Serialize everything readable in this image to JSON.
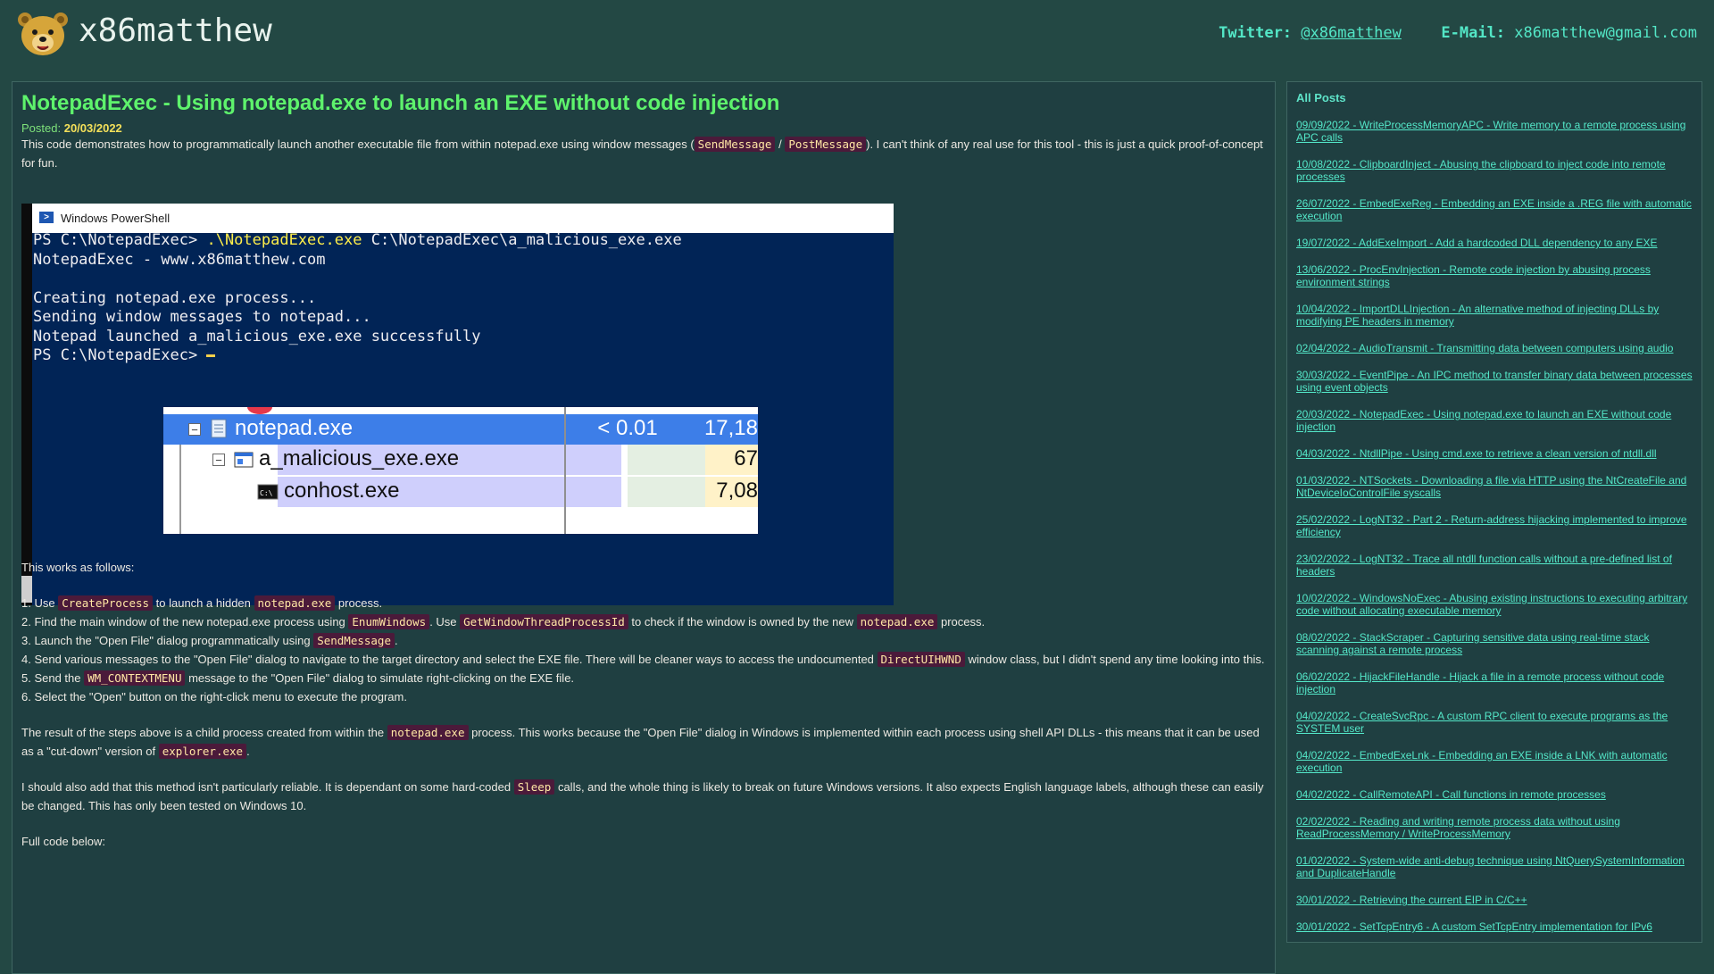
{
  "header": {
    "site_name": "x86matthew",
    "twitter_label": "Twitter:",
    "twitter_handle": "@x86matthew",
    "email_label": "E-Mail:",
    "email": "x86matthew@gmail.com"
  },
  "post": {
    "title": "NotepadExec - Using notepad.exe to launch an EXE without code injection",
    "posted_label": "Posted:",
    "posted_date": "20/03/2022",
    "intro_a": "This code demonstrates how to programmatically launch another executable file from within notepad.exe using window messages (",
    "intro_code1": "SendMessage",
    "intro_sep": " / ",
    "intro_code2": "PostMessage",
    "intro_b": "). I can't think of any real use for this tool - this is just a quick proof-of-concept for fun.",
    "works_as_follows": "This works as follows:",
    "step1": {
      "a": "1. Use ",
      "c1": "CreateProcess",
      "b": " to launch a hidden ",
      "c2": "notepad.exe",
      "d": " process."
    },
    "step2": {
      "a": "2. Find the main window of the new notepad.exe process using ",
      "c1": "EnumWindows",
      "b": ". Use ",
      "c2": "GetWindowThreadProcessId",
      "d": " to check if the window is owned by the new ",
      "c3": "notepad.exe",
      "e": " process."
    },
    "step3": {
      "a": "3. Launch the \"Open File\" dialog programmatically using ",
      "c1": "SendMessage",
      "b": "."
    },
    "step4": {
      "a": "4. Send various messages to the \"Open File\" dialog to navigate to the target directory and select the EXE file. There will be cleaner ways to access the undocumented ",
      "c1": "DirectUIHWND",
      "b": " window class, but I didn't spend any time looking into this."
    },
    "step5": {
      "a": "5. Send the ",
      "c1": "WM_CONTEXTMENU",
      "b": " message to the \"Open File\" dialog to simulate right-clicking on the EXE file."
    },
    "step6": {
      "a": "6. Select the \"Open\" button on the right-click menu to execute the program."
    },
    "result": {
      "a": "The result of the steps above is a child process created from within the ",
      "c1": "notepad.exe",
      "b": " process. This works because the \"Open File\" dialog in Windows is implemented within each process using shell API DLLs - this means that it can be used as a \"cut-down\" version of ",
      "c2": "explorer.exe",
      "d": "."
    },
    "reliability": {
      "a": "I should also add that this method isn't particularly reliable. It is dependant on some hard-coded ",
      "c1": "Sleep",
      "b": " calls, and the whole thing is likely to break on future Windows versions. It also expects English language labels, although these can easily be changed. This has only been tested on Windows 10."
    },
    "full_code": "Full code below:"
  },
  "screenshot": {
    "window_title": "Windows PowerShell",
    "prompt1": "PS C:\\NotepadExec> ",
    "command": ".\\NotepadExec.exe",
    "command_arg": " C:\\NotepadExec\\a_malicious_exe.exe",
    "line2": "NotepadExec - www.x86matthew.com",
    "line3": "Creating notepad.exe process...",
    "line4": "Sending window messages to notepad...",
    "line5": "Notepad launched a_malicious_exe.exe successfully",
    "prompt2": "PS C:\\NotepadExec> ",
    "process_tree": {
      "row1_name": "notepad.exe",
      "row1_cpu": "< 0.01",
      "row1_mem": "17,18",
      "row2_name": "a_malicious_exe.exe",
      "row2_mem": "67",
      "row3_name": "conhost.exe",
      "row3_mem": "7,08"
    }
  },
  "sidebar": {
    "title": "All Posts",
    "posts": [
      "09/09/2022 - WriteProcessMemoryAPC - Write memory to a remote process using APC calls",
      "10/08/2022 - ClipboardInject - Abusing the clipboard to inject code into remote processes",
      "26/07/2022 - EmbedExeReg - Embedding an EXE inside a .REG file with automatic execution",
      "19/07/2022 - AddExeImport - Add a hardcoded DLL dependency to any EXE",
      "13/06/2022 - ProcEnvInjection - Remote code injection by abusing process environment strings",
      "10/04/2022 - ImportDLLInjection - An alternative method of injecting DLLs by modifying PE headers in memory",
      "02/04/2022 - AudioTransmit - Transmitting data between computers using audio",
      "30/03/2022 - EventPipe - An IPC method to transfer binary data between processes using event objects",
      "20/03/2022 - NotepadExec - Using notepad.exe to launch an EXE without code injection",
      "04/03/2022 - NtdllPipe - Using cmd.exe to retrieve a clean version of ntdll.dll",
      "01/03/2022 - NTSockets - Downloading a file via HTTP using the NtCreateFile and NtDeviceIoControlFile syscalls",
      "25/02/2022 - LogNT32 - Part 2 - Return-address hijacking implemented to improve efficiency",
      "23/02/2022 - LogNT32 - Trace all ntdll function calls without a pre-defined list of headers",
      "10/02/2022 - WindowsNoExec - Abusing existing instructions to executing arbitrary code without allocating executable memory",
      "08/02/2022 - StackScraper - Capturing sensitive data using real-time stack scanning against a remote process",
      "06/02/2022 - HijackFileHandle - Hijack a file in a remote process without code injection",
      "04/02/2022 - CreateSvcRpc - A custom RPC client to execute programs as the SYSTEM user",
      "04/02/2022 - EmbedExeLnk - Embedding an EXE inside a LNK with automatic execution",
      "04/02/2022 - CallRemoteAPI - Call functions in remote processes",
      "02/02/2022 - Reading and writing remote process data without using ReadProcessMemory / WriteProcessMemory",
      "01/02/2022 - System-wide anti-debug technique using NtQuerySystemInformation and DuplicateHandle",
      "30/01/2022 - Retrieving the current EIP in C/C++",
      "30/01/2022 - SetTcpEntry6 - A custom SetTcpEntry implementation for IPv6"
    ]
  },
  "colors": {
    "page_bg": "#234844",
    "panel_bg": "#1f3f41",
    "title_green": "#5ef36c",
    "link_teal": "#54e8c9",
    "code_bg": "#4b1a3a",
    "code_fg": "#ffe7a4"
  }
}
